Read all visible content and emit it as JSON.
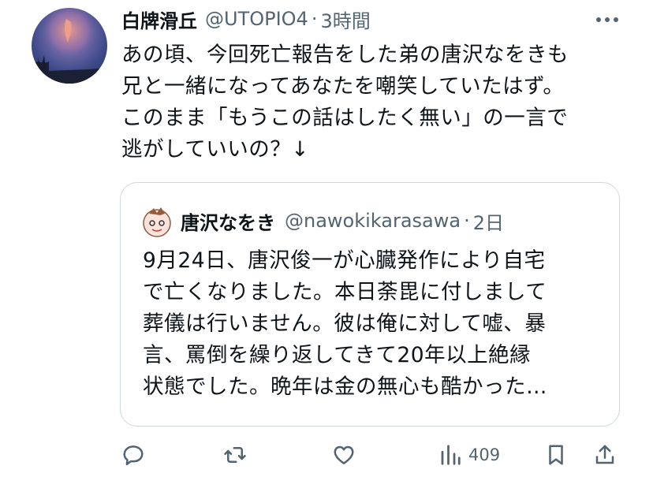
{
  "tweet": {
    "author_name": "白牌滑丘",
    "handle": "@UTOPIO4",
    "separator": "·",
    "time": "3時間",
    "text_lines": [
      "あの頃、今回死亡報告をした弟の唐沢なをきも",
      "兄と一緒になってあなたを嘲笑していたはず。",
      "このまま「もうこの話はしたく無い」の一言で",
      "逃がしていいの？↓"
    ]
  },
  "quote": {
    "author_name": "唐沢なをき",
    "handle": "@nawokikarasawa",
    "separator": "·",
    "time": "2日",
    "text_lines": [
      "9月24日、唐沢俊一が心臓発作により自宅",
      "で亡くなりました。本日荼毘に付しまして",
      "葬儀は行いません。彼は俺に対して嘘、暴",
      "言、罵倒を繰り返してきて20年以上絶縁",
      "状態でした。晩年は金の無心も酷かった…"
    ]
  },
  "actions": {
    "reply_icon": "reply-icon",
    "retweet_icon": "retweet-icon",
    "like_icon": "heart-icon",
    "views_icon": "views-icon",
    "views_count": "409",
    "bookmark_icon": "bookmark-icon",
    "share_icon": "share-icon"
  },
  "colors": {
    "text": "#0f1419",
    "secondary": "#536471",
    "border": "#cfd9de"
  }
}
